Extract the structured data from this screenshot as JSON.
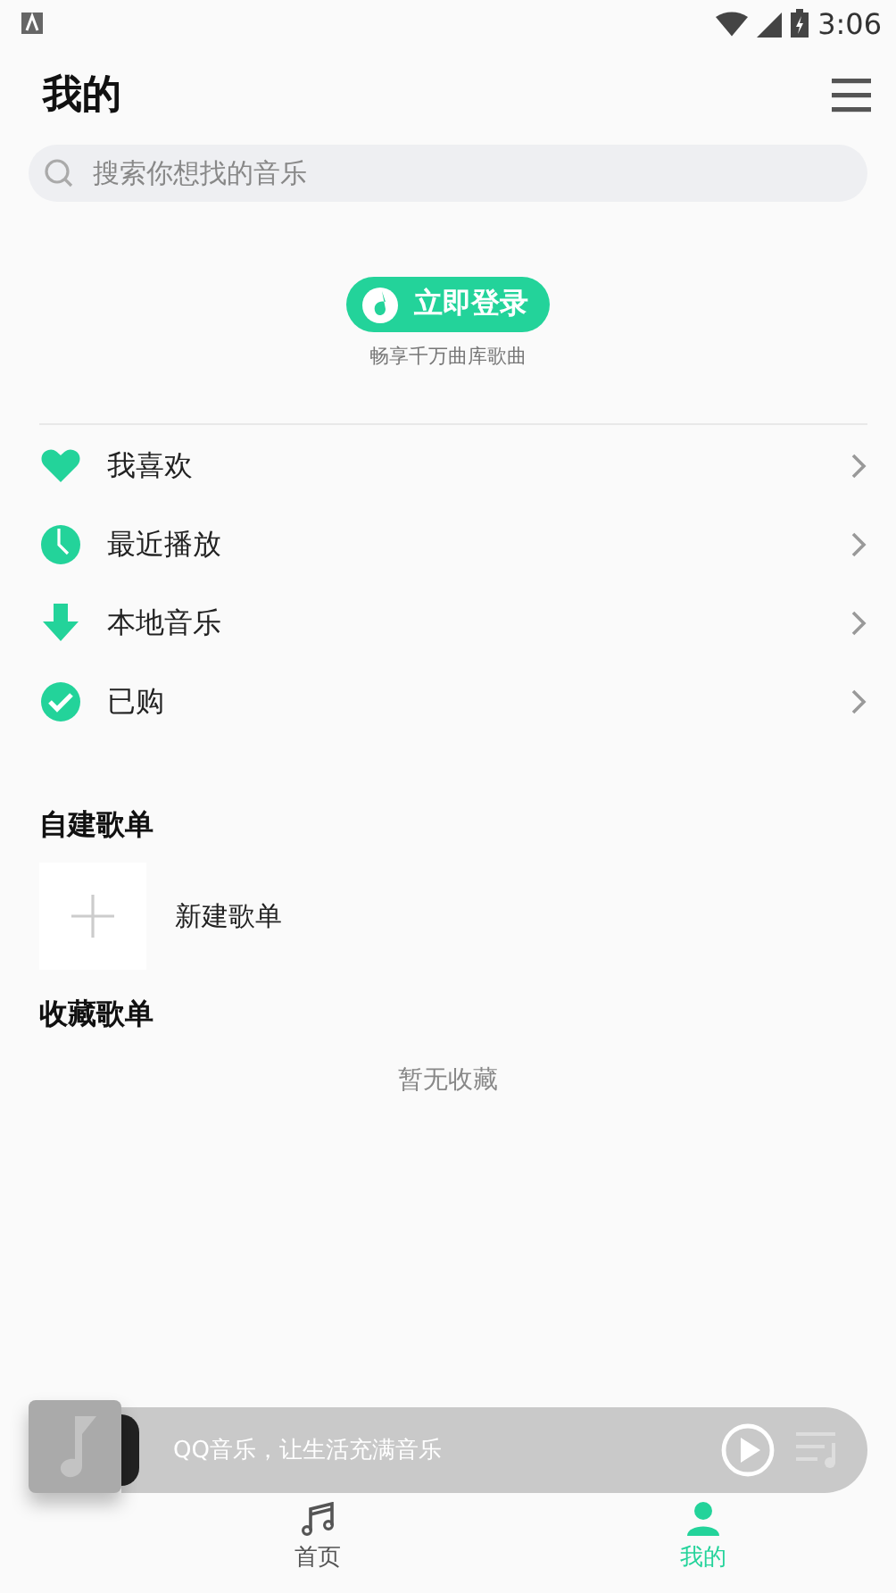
{
  "status_bar": {
    "time": "3:06"
  },
  "header": {
    "title": "我的"
  },
  "search": {
    "placeholder": "搜索你想找的音乐"
  },
  "login": {
    "button": "立即登录",
    "subtitle": "畅享千万曲库歌曲"
  },
  "menu": [
    {
      "kind": "heart",
      "label": "我喜欢"
    },
    {
      "kind": "clock",
      "label": "最近播放"
    },
    {
      "kind": "download",
      "label": "本地音乐"
    },
    {
      "kind": "check",
      "label": "已购"
    }
  ],
  "created_playlists": {
    "title": "自建歌单",
    "new_label": "新建歌单"
  },
  "collected_playlists": {
    "title": "收藏歌单",
    "empty": "暂无收藏"
  },
  "mini_player": {
    "text": "QQ音乐，让生活充满音乐"
  },
  "tabs": [
    {
      "kind": "music",
      "label": "首页",
      "selected": false
    },
    {
      "kind": "user",
      "label": "我的",
      "selected": true
    }
  ]
}
